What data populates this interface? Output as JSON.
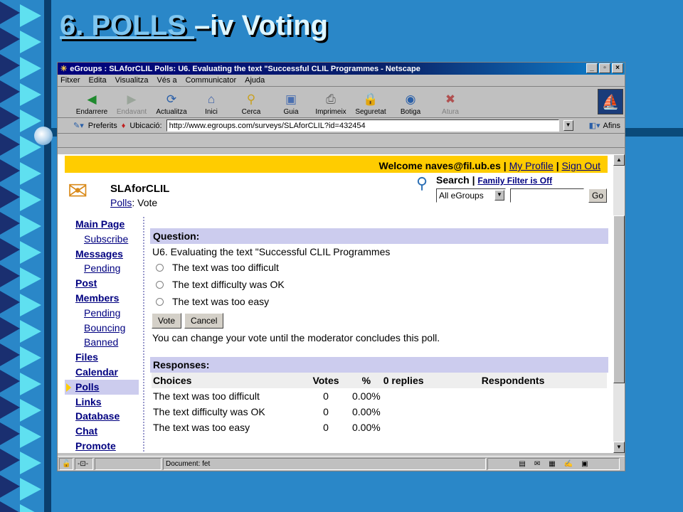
{
  "slide": {
    "title_link": "6. POLLS ",
    "title_rest": "–iv Voting"
  },
  "window": {
    "title": "eGroups : SLAforCLIL Polls: U6. Evaluating the text \"Successful CLIL Programmes - Netscape",
    "menu": [
      "Fitxer",
      "Edita",
      "Visualitza",
      "Vés a",
      "Communicator",
      "Ajuda"
    ],
    "toolbar": [
      {
        "label": "Endarrere",
        "icon": "back-arrow-icon",
        "glyph": "◀",
        "color": "#1f8a2e",
        "disabled": false
      },
      {
        "label": "Endavant",
        "icon": "forward-arrow-icon",
        "glyph": "▶",
        "color": "#9aa59a",
        "disabled": true
      },
      {
        "label": "Actualitza",
        "icon": "reload-icon",
        "glyph": "⟳",
        "color": "#2a5fa8",
        "disabled": false
      },
      {
        "label": "Inici",
        "icon": "home-icon",
        "glyph": "⌂",
        "color": "#3a5fa8",
        "disabled": false
      },
      {
        "label": "Cerca",
        "icon": "search-icon",
        "glyph": "⚲",
        "color": "#c8a020",
        "disabled": false
      },
      {
        "label": "Guia",
        "icon": "guide-icon",
        "glyph": "▣",
        "color": "#4a6fb0",
        "disabled": false
      },
      {
        "label": "Imprimeix",
        "icon": "print-icon",
        "glyph": "⎙",
        "color": "#606060",
        "disabled": false
      },
      {
        "label": "Seguretat",
        "icon": "lock-icon",
        "glyph": "🔒",
        "color": "#b07020",
        "disabled": false
      },
      {
        "label": "Botiga",
        "icon": "shop-icon",
        "glyph": "◉",
        "color": "#2a5fa8",
        "disabled": false
      },
      {
        "label": "Atura",
        "icon": "stop-icon",
        "glyph": "✖",
        "color": "#b05050",
        "disabled": true
      }
    ],
    "location": {
      "bookmarks_label": "Preferits",
      "location_label": "Ubicació:",
      "url": "http://www.egroups.com/surveys/SLAforCLIL?id=432454",
      "related_label": "Afins"
    },
    "status_text": "Document: fet"
  },
  "page": {
    "welcome_prefix": "Welcome naves@fil.ub.es",
    "my_profile": "My Profile",
    "sign_out": "Sign Out",
    "group_name": "SLAforCLIL",
    "crumb_link": "Polls",
    "crumb_rest": ": Vote",
    "search_label": "Search",
    "family_filter": "Family Filter is Off",
    "search_scope": "All eGroups",
    "go_label": "Go",
    "nav": [
      {
        "label": "Main Page",
        "sub": false,
        "active": false
      },
      {
        "label": "Subscribe",
        "sub": true,
        "active": false
      },
      {
        "label": "Messages",
        "sub": false,
        "active": false
      },
      {
        "label": "Pending",
        "sub": true,
        "active": false
      },
      {
        "label": "Post",
        "sub": false,
        "active": false
      },
      {
        "label": "Members",
        "sub": false,
        "active": false
      },
      {
        "label": "Pending",
        "sub": true,
        "active": false
      },
      {
        "label": "Bouncing",
        "sub": true,
        "active": false
      },
      {
        "label": "Banned",
        "sub": true,
        "active": false
      },
      {
        "label": "Files",
        "sub": false,
        "active": false
      },
      {
        "label": "Calendar",
        "sub": false,
        "active": false
      },
      {
        "label": "Polls",
        "sub": false,
        "active": true
      },
      {
        "label": "Links",
        "sub": false,
        "active": false
      },
      {
        "label": "Database",
        "sub": false,
        "active": false
      },
      {
        "label": "Chat",
        "sub": false,
        "active": false
      },
      {
        "label": "Promote",
        "sub": false,
        "active": false
      }
    ],
    "question_header": "Question:",
    "question_text": "U6. Evaluating the text \"Successful CLIL Programmes",
    "options": [
      "The text was too difficult",
      "The text difficulty was OK",
      "The text was too easy"
    ],
    "vote_button": "Vote",
    "cancel_button": "Cancel",
    "change_note": "You can change your vote until the moderator concludes this poll.",
    "responses_header": "Responses:",
    "columns": {
      "choices": "Choices",
      "votes": "Votes",
      "pct": "%",
      "replies": "0 replies",
      "respondents": "Respondents"
    },
    "rows": [
      {
        "choice": "The text was too difficult",
        "votes": "0",
        "pct": "0.00%"
      },
      {
        "choice": "The text difficulty was OK",
        "votes": "0",
        "pct": "0.00%"
      },
      {
        "choice": "The text was too easy",
        "votes": "0",
        "pct": "0.00%"
      }
    ]
  }
}
